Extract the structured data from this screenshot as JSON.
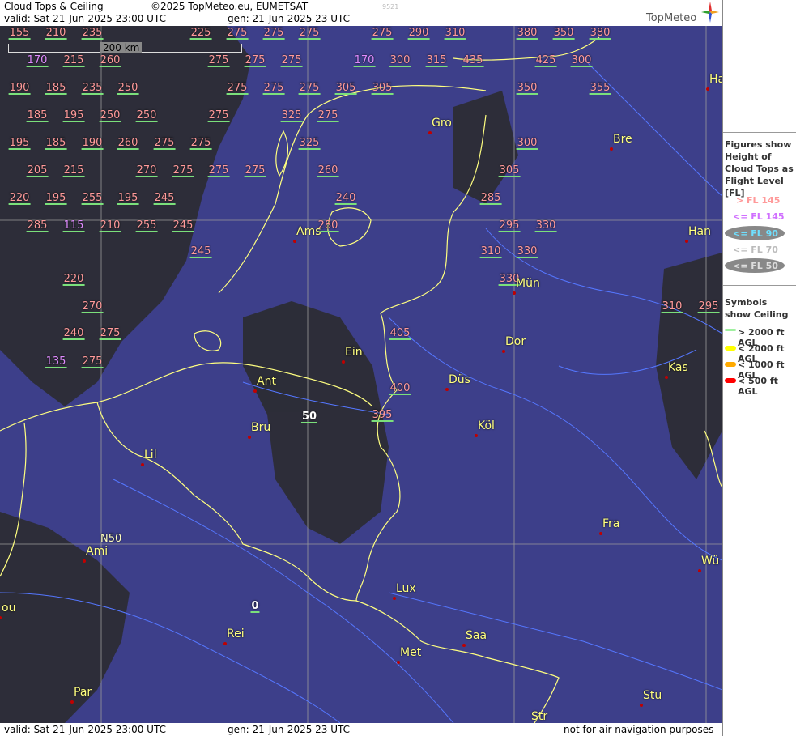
{
  "header": {
    "title": "Cloud Tops & Ceiling",
    "copyright": "©2025 TopMeteo.eu, EUMETSAT",
    "valid_line": "valid:  Sat  21-Jun-2025  23:00 UTC",
    "gen_line": "gen: 21-Jun-2025 23 UTC",
    "code": "9521",
    "brand": "TopMeteo"
  },
  "footer": {
    "valid_line": "valid:  Sat  21-Jun-2025  23:00 UTC",
    "gen_line": "gen: 21-Jun-2025 23 UTC",
    "disclaimer": "not for air navigation purposes"
  },
  "scale": {
    "label": "200 km"
  },
  "grid_label": "N50",
  "legend": {
    "figures_title": "Figures show Height of Cloud Tops as Flight Level  [FL]",
    "fl_items": [
      {
        "label": "> FL 145",
        "color": "#ff9a9a"
      },
      {
        "label": "<= FL 145",
        "color": "#d070ff"
      },
      {
        "label": "<= FL 90",
        "color": "#6fe0ff"
      },
      {
        "label": "<= FL 70",
        "color": "#bbbbbb"
      },
      {
        "label": "<= FL 50",
        "color": "#dddddd"
      }
    ],
    "symbols_title": "Symbols show Ceiling",
    "symbol_items": [
      {
        "label": "> 2000 ft AGL",
        "color": "#a0f0a0"
      },
      {
        "label": "< 2000 ft AGL",
        "color": "#ffff00"
      },
      {
        "label": "< 1000 ft AGL",
        "color": "#ffaa00"
      },
      {
        "label": "< 500 ft AGL",
        "color": "#ff0000"
      }
    ]
  },
  "cities": [
    "Gro",
    "Bre",
    "Ams",
    "Han",
    "Mün",
    "Ein",
    "Dor",
    "Ant",
    "Düs",
    "Kas",
    "Bru",
    "Köl",
    "Lil",
    "Ami",
    "Fra",
    "Wü",
    "Lux",
    "ou",
    "Rei",
    "Saa",
    "Met",
    "Par",
    "Stu",
    "Str",
    "Ha"
  ],
  "flight_levels": [
    "155",
    "210",
    "235",
    "225",
    "275",
    "275",
    "275",
    "275",
    "290",
    "310",
    "380",
    "350",
    "380",
    "170",
    "215",
    "260",
    "275",
    "275",
    "275",
    "170",
    "300",
    "315",
    "435",
    "425",
    "300",
    "190",
    "185",
    "235",
    "250",
    "275",
    "275",
    "275",
    "305",
    "305",
    "350",
    "355",
    "185",
    "195",
    "250",
    "250",
    "275",
    "325",
    "275",
    "195",
    "185",
    "190",
    "260",
    "275",
    "275",
    "325",
    "300",
    "205",
    "215",
    "270",
    "275",
    "275",
    "275",
    "260",
    "305",
    "220",
    "195",
    "255",
    "195",
    "245",
    "240",
    "285",
    "285",
    "115",
    "210",
    "255",
    "245",
    "280",
    "295",
    "330",
    "245",
    "310",
    "330",
    "220",
    "330",
    "270",
    "310",
    "295",
    "240",
    "275",
    "405",
    "135",
    "275",
    "400",
    "395",
    "50",
    "0"
  ],
  "colors": {
    "map_bg": "#3d3f8a",
    "border": "#ffff80",
    "river": "#5577ff",
    "grid": "#9a9a9a"
  }
}
